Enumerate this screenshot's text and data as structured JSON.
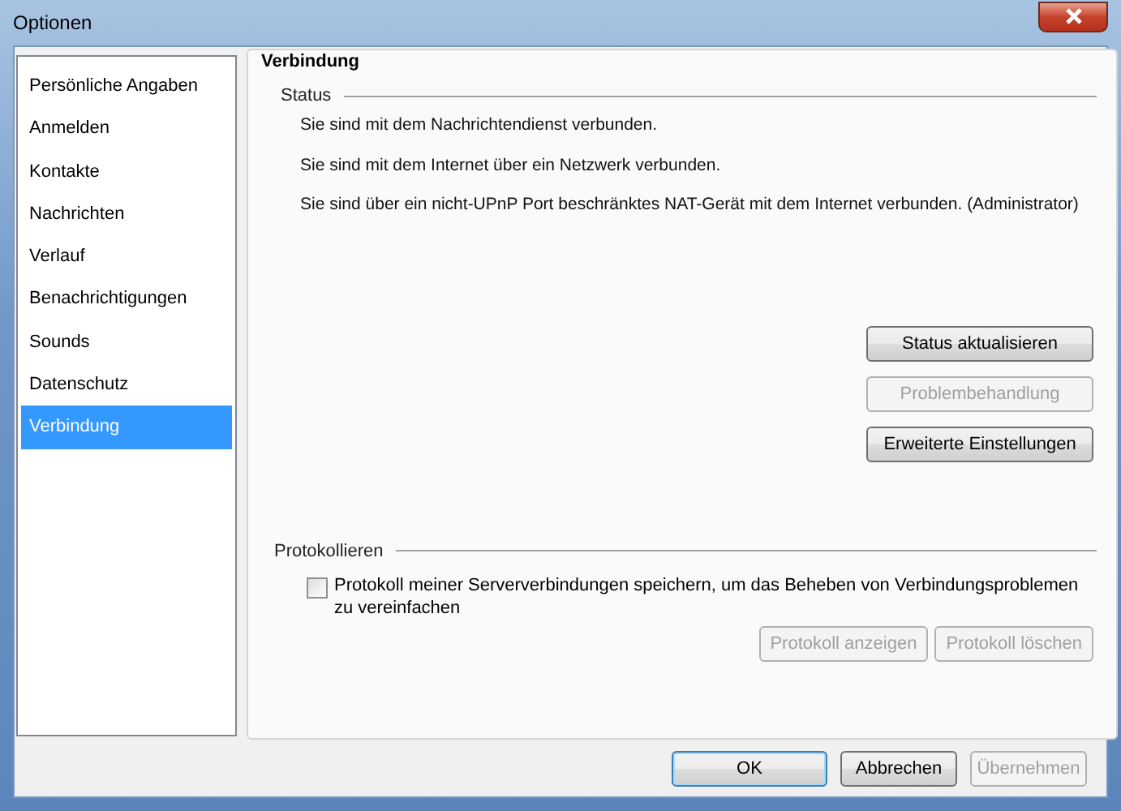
{
  "window": {
    "title": "Optionen"
  },
  "sidebar": {
    "items": [
      {
        "label": "Persönliche Angaben",
        "selected": false
      },
      {
        "label": "Anmelden",
        "selected": false
      },
      {
        "label": "Kontakte",
        "selected": false
      },
      {
        "label": "Nachrichten",
        "selected": false
      },
      {
        "label": "Verlauf",
        "selected": false
      },
      {
        "label": "Benachrichtigungen",
        "selected": false
      },
      {
        "label": "Sounds",
        "selected": false
      },
      {
        "label": "Datenschutz",
        "selected": false
      },
      {
        "label": "Verbindung",
        "selected": true
      }
    ]
  },
  "panel": {
    "title": "Verbindung",
    "status": {
      "heading": "Status",
      "messages": [
        "Sie sind mit dem Nachrichtendienst verbunden.",
        "Sie sind mit dem Internet über ein Netzwerk verbunden.",
        "Sie sind über ein nicht-UPnP Port beschränktes NAT-Gerät mit dem Internet verbunden.  (Administrator)"
      ],
      "buttons": [
        {
          "label": "Status aktualisieren",
          "disabled": false
        },
        {
          "label": "Problembehandlung",
          "disabled": true
        },
        {
          "label": "Erweiterte Einstellungen",
          "disabled": false
        }
      ]
    },
    "logging": {
      "heading": "Protokollieren",
      "checkbox": {
        "label": "Protokoll meiner Serververbindungen speichern, um das Beheben von Verbindungsproblemen zu vereinfachen",
        "checked": false
      },
      "buttons": [
        {
          "label": "Protokoll anzeigen",
          "disabled": true
        },
        {
          "label": "Protokoll löschen",
          "disabled": true
        }
      ]
    }
  },
  "buttons": [
    {
      "label": "OK",
      "disabled": false,
      "default": true
    },
    {
      "label": "Abbrechen",
      "disabled": false,
      "default": false
    },
    {
      "label": "Übernehmen",
      "disabled": true,
      "default": false
    }
  ]
}
